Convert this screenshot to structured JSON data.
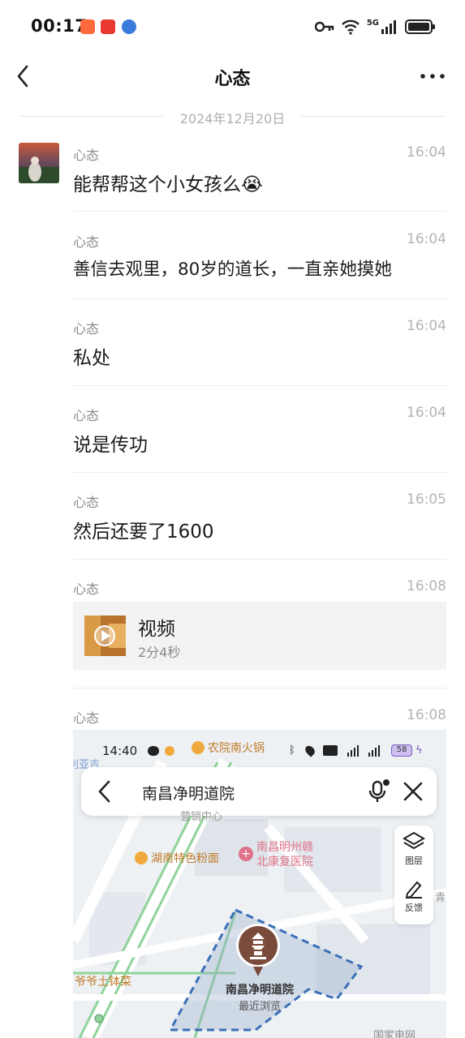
{
  "status_bar": {
    "time": "00:17",
    "network": "5G"
  },
  "nav": {
    "title": "心态"
  },
  "date_divider": "2024年12月20日",
  "messages": [
    {
      "sender": "心态",
      "time": "16:04",
      "text": "能帮帮这个小女孩么😭"
    },
    {
      "sender": "心态",
      "time": "16:04",
      "text": "善信去观里，80岁的道长，一直亲她摸她"
    },
    {
      "sender": "心态",
      "time": "16:04",
      "text": "私处"
    },
    {
      "sender": "心态",
      "time": "16:04",
      "text": "说是传功"
    },
    {
      "sender": "心态",
      "time": "16:05",
      "text": "然后还要了1600"
    },
    {
      "sender": "心态",
      "time": "16:08",
      "video_title": "视频",
      "video_duration": "2分4秒"
    },
    {
      "sender": "心态",
      "time": "16:08"
    }
  ],
  "map_screenshot": {
    "status_time": "14:40",
    "search_text": "南昌净明道院",
    "tool_layers": "图层",
    "tool_feedback": "反馈",
    "poi_hotpot": "农院南火锅",
    "poi_restaurant": "湖南特色粉面",
    "poi_hospital": "南昌明州赣北康复医院",
    "poi_left_top": "利亚吉",
    "poi_dish": "爷爷土钵菜",
    "poi_mid": "营销中心",
    "poi_right": "青",
    "poi_bottom": "国家电网",
    "place_name": "南昌净明道院",
    "place_sub": "最近浏览",
    "battery": "58"
  },
  "colors": {
    "accent_map_pin": "#7a4a3a",
    "map_road_green": "#8fd39b",
    "map_boundary": "#3a6fb8"
  }
}
